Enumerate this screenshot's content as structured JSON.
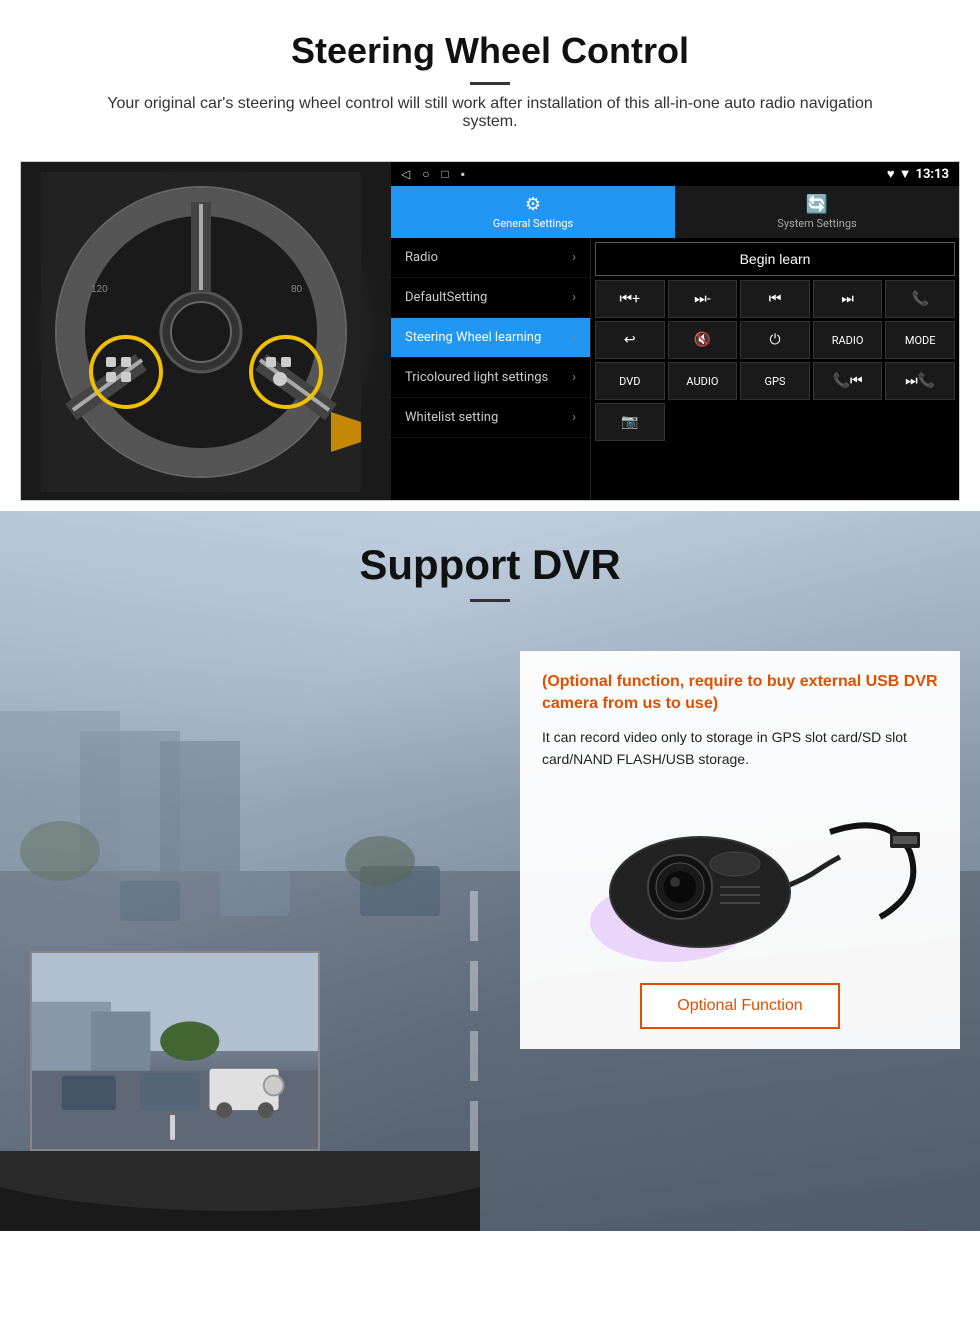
{
  "steering_section": {
    "title": "Steering Wheel Control",
    "description": "Your original car's steering wheel control will still work after installation of this all-in-one auto radio navigation system.",
    "statusbar": {
      "nav_icons": [
        "◁",
        "○",
        "□",
        "▪"
      ],
      "status": "♥ ▼",
      "time": "13:13"
    },
    "tabs": [
      {
        "id": "general",
        "icon": "⚙",
        "label": "General Settings",
        "active": true
      },
      {
        "id": "system",
        "icon": "🔄",
        "label": "System Settings",
        "active": false
      }
    ],
    "menu_items": [
      {
        "label": "Radio",
        "active": false
      },
      {
        "label": "DefaultSetting",
        "active": false
      },
      {
        "label": "Steering Wheel learning",
        "active": true
      },
      {
        "label": "Tricoloured light settings",
        "active": false
      },
      {
        "label": "Whitelist setting",
        "active": false
      }
    ],
    "begin_learn_label": "Begin learn",
    "control_buttons": [
      {
        "icon": "⏮+",
        "label": "vol+"
      },
      {
        "icon": "⏭-",
        "label": "vol-"
      },
      {
        "icon": "⏮|",
        "label": "prev"
      },
      {
        "icon": "|⏭",
        "label": "next"
      },
      {
        "icon": "📞",
        "label": "call"
      },
      {
        "icon": "↩",
        "label": "back"
      },
      {
        "icon": "🔇x",
        "label": "mute"
      },
      {
        "icon": "⏻",
        "label": "power"
      },
      {
        "icon": "RADIO",
        "label": "radio"
      },
      {
        "icon": "MODE",
        "label": "mode"
      },
      {
        "icon": "DVD",
        "label": "dvd"
      },
      {
        "icon": "AUDIO",
        "label": "audio"
      },
      {
        "icon": "GPS",
        "label": "gps"
      },
      {
        "icon": "📞⏮|",
        "label": "tel-prev"
      },
      {
        "icon": "⌛|⏭",
        "label": "tel-next"
      },
      {
        "icon": "📷",
        "label": "camera"
      }
    ]
  },
  "dvr_section": {
    "title": "Support DVR",
    "optional_text": "(Optional function, require to buy external USB DVR camera from us to use)",
    "description": "It can record video only to storage in GPS slot card/SD slot card/NAND FLASH/USB storage.",
    "optional_function_btn": "Optional Function"
  }
}
